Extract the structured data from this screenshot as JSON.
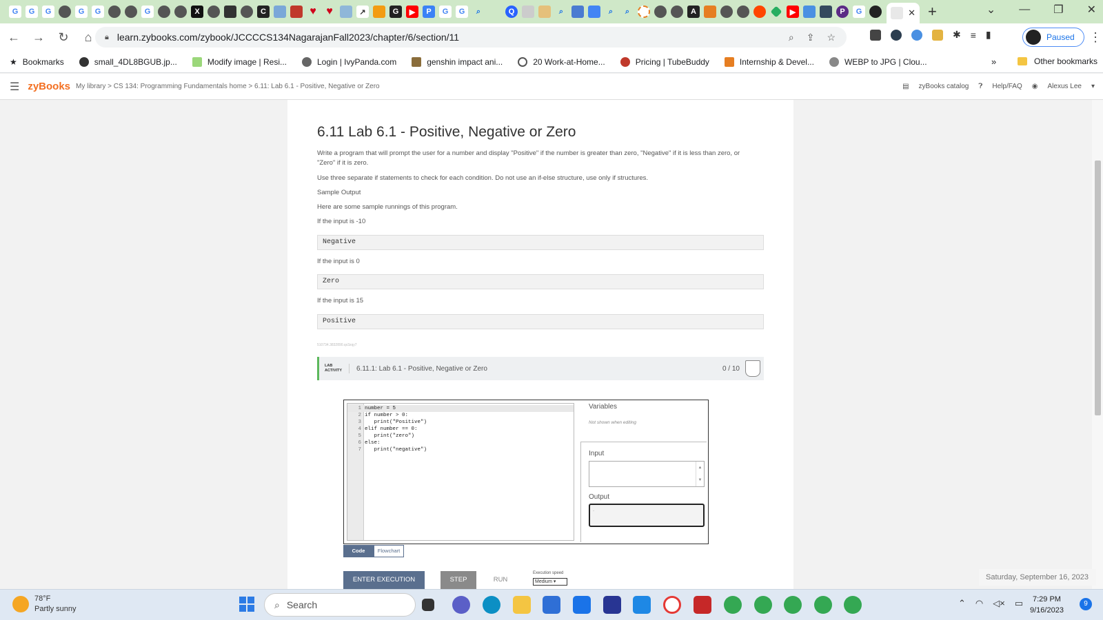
{
  "browser": {
    "url": "learn.zybooks.com/zybook/JCCCCS134NagarajanFall2023/chapter/6/section/11",
    "profile_label": "Paused",
    "bookmarks": [
      "Bookmarks",
      "small_4DL8BGUB.jp...",
      "Modify image | Resi...",
      "Login | IvyPanda.com",
      "genshin impact ani...",
      "20 Work-at-Home...",
      "Pricing | TubeBuddy",
      "Internship & Devel...",
      "WEBP to JPG | Clou..."
    ],
    "other_bookmarks": "Other bookmarks",
    "more_chevron": "»"
  },
  "zybooks": {
    "logo": "zyBooks",
    "breadcrumb": "My library > CS 134: Programming Fundamentals home > 6.11: Lab 6.1 - Positive, Negative or Zero",
    "catalog": "zyBooks catalog",
    "help": "Help/FAQ",
    "user": "Alexus Lee"
  },
  "section": {
    "title": "6.11 Lab 6.1 - Positive, Negative or Zero",
    "para1": "Write a program that will prompt the user for a number and display \"Positive\" if the number is greater than zero, \"Negative\" if it is less than zero, or \"Zero\" if it is zero.",
    "para2": "Use three separate if statements to check for each condition. Do not use an if-else structure, use only if structures.",
    "para3": "Sample Output",
    "para4": "Here are some sample runnings of this program.",
    "input1_text": "If the input is -10",
    "output1": "Negative",
    "input2_text": "If the input is 0",
    "output2": "Zero",
    "input3_text": "If the input is 15",
    "output3": "Positive",
    "tiny_id": "510734.3832890.qx3zqy7"
  },
  "lab": {
    "tag_line1": "LAB",
    "tag_line2": "ACTIVITY",
    "name": "6.11.1: Lab 6.1 - Positive, Negative or Zero",
    "score": "0 / 10",
    "code": [
      {
        "n": "1",
        "t": "number = 5"
      },
      {
        "n": "2",
        "t": "if number > 0:"
      },
      {
        "n": "3",
        "t": "   print(\"Positive\")"
      },
      {
        "n": "4",
        "t": "elif number == 0:"
      },
      {
        "n": "5",
        "t": "   print(\"zero\")"
      },
      {
        "n": "6",
        "t": "else:"
      },
      {
        "n": "7",
        "t": "   print(\"negative\")"
      }
    ],
    "variables_title": "Variables",
    "variables_note": "Not shown when editing",
    "input_label": "Input",
    "output_label": "Output",
    "output_value": "-",
    "tab_code": "Code",
    "tab_flowchart": "Flowchart",
    "btn_enter": "ENTER EXECUTION",
    "btn_step": "STEP",
    "btn_run": "RUN",
    "speed_label": "Execution speed",
    "speed_value": "Medium"
  },
  "system": {
    "date_toast": "Saturday, September 16, 2023",
    "temperature": "78°F",
    "weather": "Partly sunny",
    "search_placeholder": "Search",
    "time": "7:29 PM",
    "date": "9/16/2023",
    "notifications": "9"
  }
}
